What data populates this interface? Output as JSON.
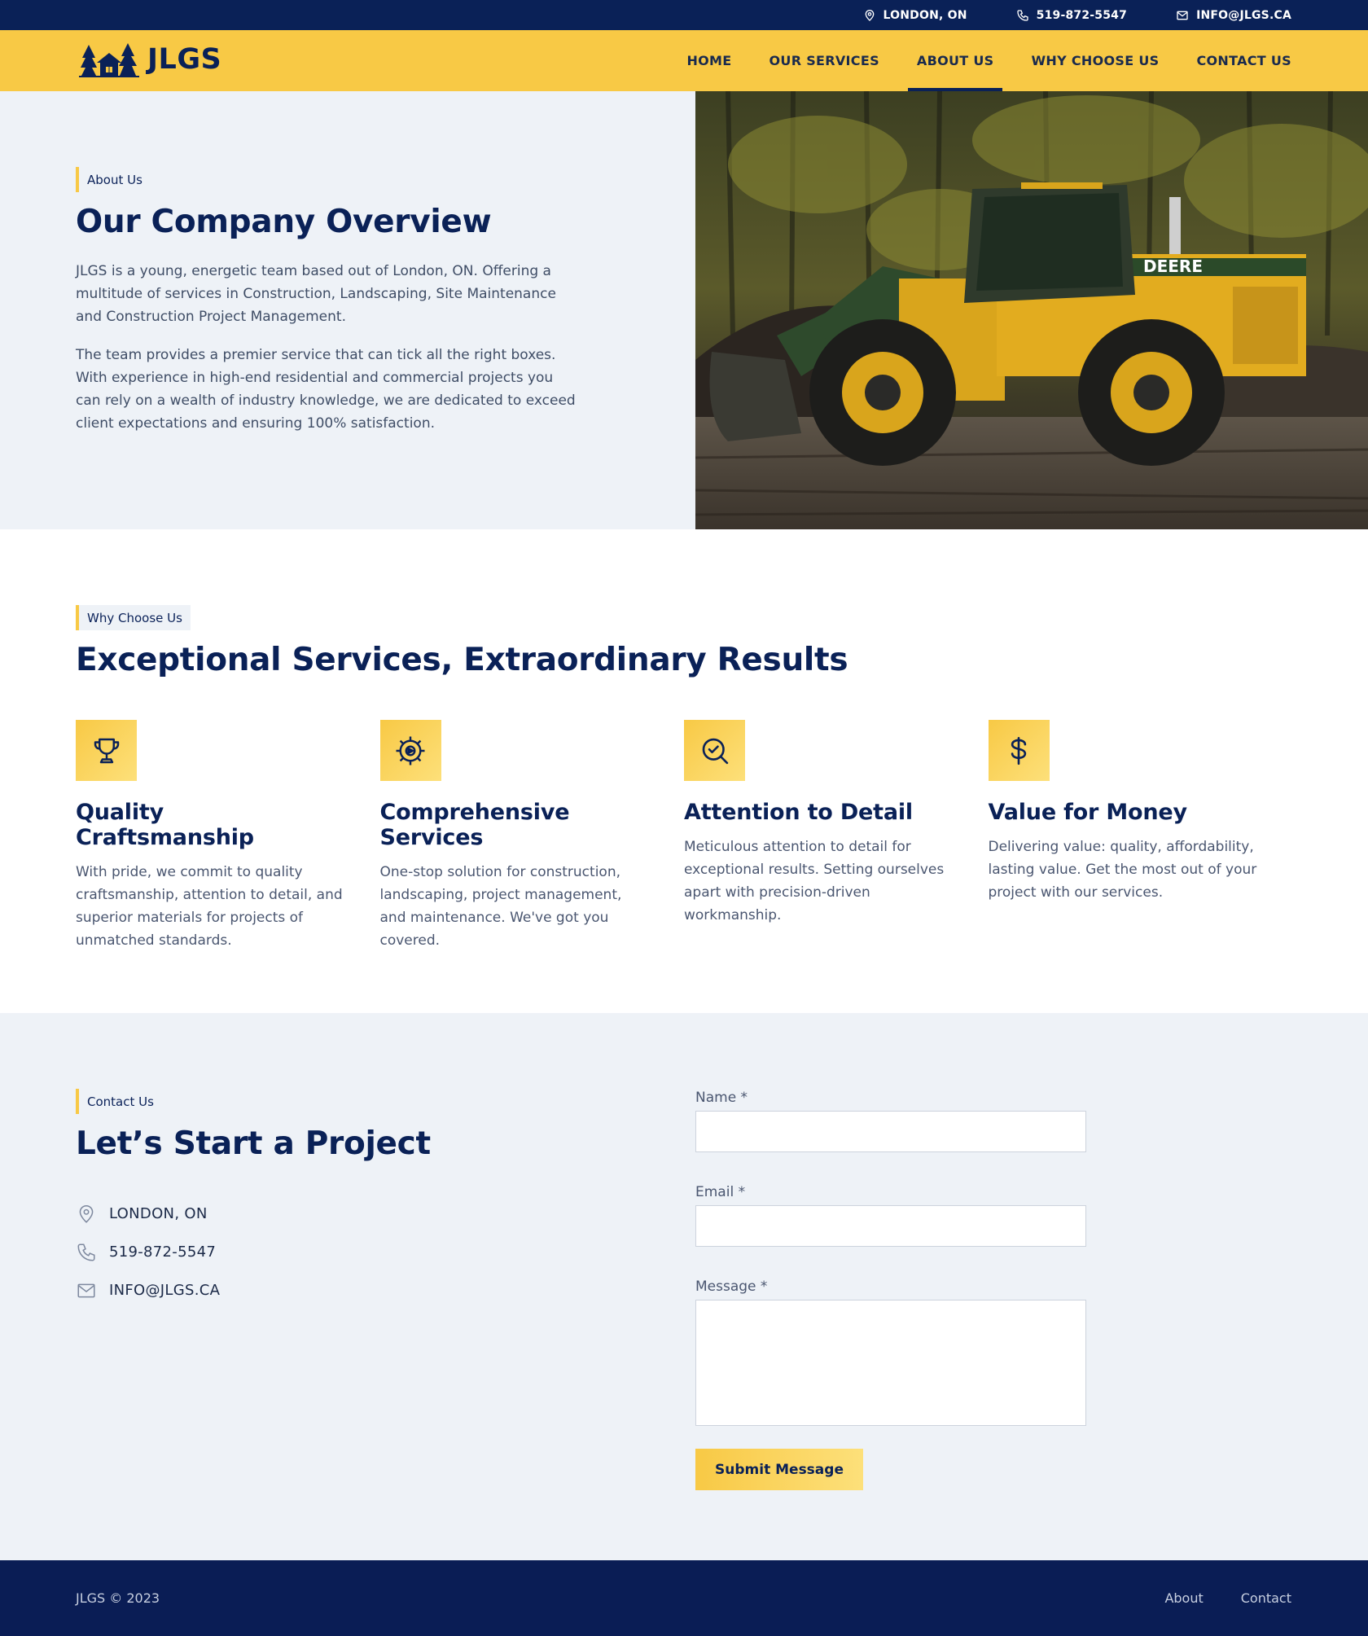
{
  "topbar": {
    "location": "LONDON, ON",
    "phone": "519-872-5547",
    "email": "INFO@JLGS.CA"
  },
  "header": {
    "logo_text": "JLGS",
    "nav": [
      {
        "label": "HOME",
        "active": false
      },
      {
        "label": "OUR SERVICES",
        "active": false
      },
      {
        "label": "ABOUT US",
        "active": true
      },
      {
        "label": "WHY CHOOSE US",
        "active": false
      },
      {
        "label": "CONTACT US",
        "active": false
      }
    ]
  },
  "about": {
    "eyebrow": "About Us",
    "title": "Our Company Overview",
    "paragraphs": [
      "JLGS is a young, energetic team based out of London, ON. Offering a multitude of services in Construction, Landscaping, Site Maintenance and Construction Project Management.",
      "The team provides a premier service that can tick all the right boxes. With experience in high-end residential and commercial projects you can rely on a wealth of industry knowledge, we are dedicated to exceed client expectations and ensuring 100% satisfaction."
    ],
    "image_icon": "wheel-loader-photo"
  },
  "why": {
    "eyebrow": "Why Choose Us",
    "title": "Exceptional Services, Extraordinary Results",
    "features": [
      {
        "icon": "trophy-icon",
        "title": "Quality Craftsmanship",
        "desc": "With pride, we commit to quality craftsmanship, attention to detail, and superior materials for projects of unmatched standards."
      },
      {
        "icon": "gear-icon",
        "title": "Comprehensive Services",
        "desc": "One-stop solution for construction, landscaping, project management, and maintenance. We've got you covered."
      },
      {
        "icon": "magnifier-check-icon",
        "title": "Attention to Detail",
        "desc": "Meticulous attention to detail for exceptional results. Setting ourselves apart with precision-driven workmanship."
      },
      {
        "icon": "dollar-icon",
        "title": "Value for Money",
        "desc": "Delivering value: quality, affordability, lasting value. Get the most out of your project with our services."
      }
    ]
  },
  "contact": {
    "eyebrow": "Contact Us",
    "title": "Let’s Start a Project",
    "location": "LONDON, ON",
    "phone": "519-872-5547",
    "email": "INFO@JLGS.CA",
    "form": {
      "name_label": "Name *",
      "name_value": "",
      "email_label": "Email *",
      "email_value": "",
      "message_label": "Message *",
      "message_value": "",
      "submit_label": "Submit Message"
    }
  },
  "footer": {
    "copyright": "JLGS © 2023",
    "links": [
      "About",
      "Contact"
    ]
  },
  "colors": {
    "navy": "#0a2157",
    "yellow": "#f8c945",
    "section_bg": "#eef2f7"
  }
}
